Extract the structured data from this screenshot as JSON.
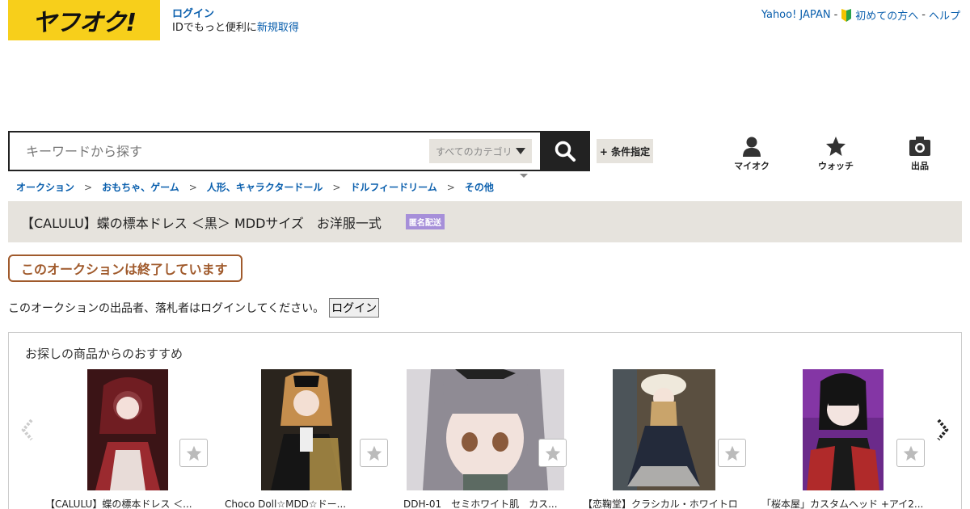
{
  "header": {
    "logo_text": "ヤフオク!",
    "login_label": "ログイン",
    "login_sub_text": "IDでもっと便利に",
    "register_label": "新規取得",
    "links": {
      "yahoo_japan": "Yahoo! JAPAN",
      "sep1": "-",
      "beginners": "初めての方へ",
      "sep2": "-",
      "help": "ヘルプ"
    }
  },
  "search": {
    "placeholder": "キーワードから探す",
    "category_label": "すべてのカテゴリ",
    "condition_label": "+ 条件指定"
  },
  "nav": {
    "myauc": "マイオク",
    "watch": "ウォッチ",
    "sell": "出品"
  },
  "breadcrumb": [
    "オークション",
    "おもちゃ、ゲーム",
    "人形、キャラクタードール",
    "ドルフィードリーム",
    "その他"
  ],
  "breadcrumb_sep": ">",
  "item": {
    "title": "【CALULU】蝶の標本ドレス ＜黒＞ MDDサイズ　お洋服一式",
    "badge": "匿名配送"
  },
  "status": {
    "ended_text": "このオークションは終了しています",
    "login_message": "このオークションの出品者、落札者はログインしてください。",
    "login_button": "ログイン"
  },
  "recommend": {
    "heading": "お探しの商品からのおすすめ",
    "items": [
      {
        "name": "【CALULU】蝶の標本ドレス ＜...",
        "image": "doll-red-dress-photo",
        "color": "#7a1f24"
      },
      {
        "name": "Choco Doll☆MDD☆ドー...",
        "image": "doll-black-gold-dress-photo",
        "color": "#3a2f22"
      },
      {
        "name": "DDH-01　セミホワイト肌　カス...",
        "image": "doll-head-closeup-photo",
        "color": "#8c8a92"
      },
      {
        "name": "【恋鞠堂】クラシカル・ホワイトロ",
        "image": "doll-classical-dress-photo",
        "color": "#6b6154"
      },
      {
        "name": "「桜本屋」カスタムヘッド +アイ2...",
        "image": "doll-dark-purple-photo",
        "color": "#4a1a5a"
      }
    ]
  },
  "colors": {
    "logo_bg": "#f7cf1b",
    "link": "#0a5fad",
    "ended": "#a05a2c",
    "badge": "#a68fd9",
    "title_bar": "#e6e3dd"
  }
}
